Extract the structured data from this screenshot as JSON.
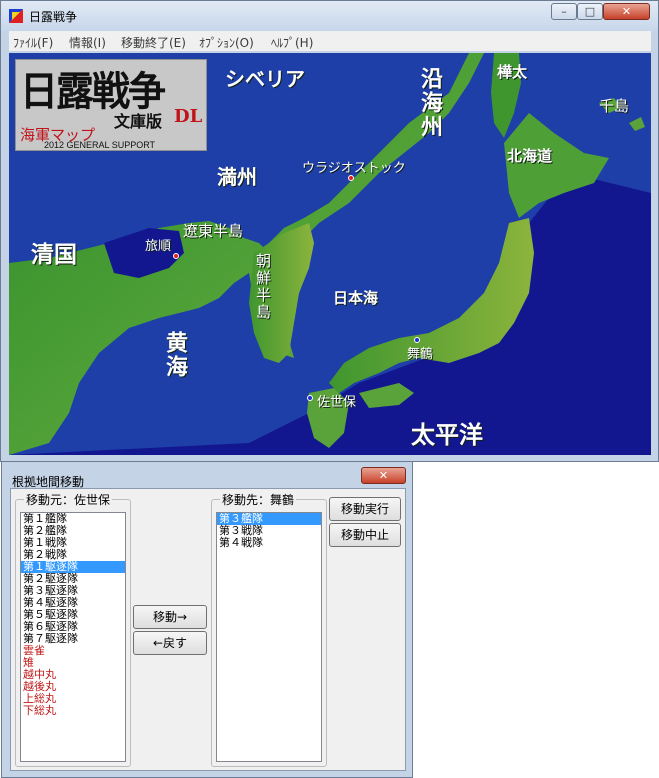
{
  "window": {
    "title": "日露戦争",
    "menu": [
      "ﾌｧｲﾙ(F)",
      "情報(I)",
      "移動終了(E)",
      "ｵﾌﾟｼｮﾝ(O)",
      "ﾍﾙﾌﾟ(H)"
    ]
  },
  "logo": {
    "title": "日露戦争",
    "edition": "文庫版",
    "edition_suffix": "DL",
    "naval_map": "海軍マップ",
    "support": "2012 GENERAL SUPPORT"
  },
  "map_labels": {
    "siberia": "シベリア",
    "enkai": "沿海州",
    "karafuto": "樺太",
    "chishima": "千島",
    "hokkaido": "北海道",
    "vladivostok": "ウラジオストック",
    "manshu": "満州",
    "liaodong": "遼東半島",
    "ryojun": "旅順",
    "shinkoku": "清国",
    "chosen": "朝鮮半島",
    "nihonkai": "日本海",
    "maizuru": "舞鶴",
    "kokai": "黄海",
    "sasebo": "佐世保",
    "taiheiyo": "太平洋"
  },
  "dialog": {
    "title": "根拠地間移動",
    "source_label": "移動元：佐世保",
    "dest_label": "移動先：舞鶴",
    "move_button": "移動→",
    "back_button": "←戻す",
    "execute_button": "移動実行",
    "cancel_button": "移動中止",
    "source_items": [
      {
        "text": "第１艦隊",
        "red": false,
        "selected": false
      },
      {
        "text": "第２艦隊",
        "red": false,
        "selected": false
      },
      {
        "text": "第１戦隊",
        "red": false,
        "selected": false
      },
      {
        "text": "第２戦隊",
        "red": false,
        "selected": false
      },
      {
        "text": "第１駆逐隊",
        "red": false,
        "selected": true
      },
      {
        "text": "第２駆逐隊",
        "red": false,
        "selected": false
      },
      {
        "text": "第３駆逐隊",
        "red": false,
        "selected": false
      },
      {
        "text": "第４駆逐隊",
        "red": false,
        "selected": false
      },
      {
        "text": "第５駆逐隊",
        "red": false,
        "selected": false
      },
      {
        "text": "第６駆逐隊",
        "red": false,
        "selected": false
      },
      {
        "text": "第７駆逐隊",
        "red": false,
        "selected": false
      },
      {
        "text": "雲雀",
        "red": true,
        "selected": false
      },
      {
        "text": "雉",
        "red": true,
        "selected": false
      },
      {
        "text": "越中丸",
        "red": true,
        "selected": false
      },
      {
        "text": "越後丸",
        "red": true,
        "selected": false
      },
      {
        "text": "上総丸",
        "red": true,
        "selected": false
      },
      {
        "text": "下総丸",
        "red": true,
        "selected": false
      }
    ],
    "dest_items": [
      {
        "text": "第３艦隊",
        "red": false,
        "selected": true
      },
      {
        "text": "第３戦隊",
        "red": false,
        "selected": false
      },
      {
        "text": "第４戦隊",
        "red": false,
        "selected": false
      }
    ]
  }
}
